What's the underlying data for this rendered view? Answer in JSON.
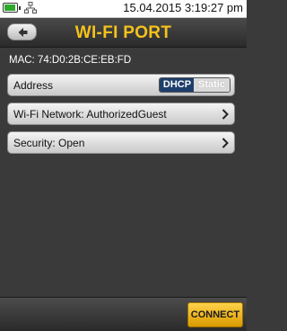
{
  "status_bar": {
    "datetime": "15.04.2015 3:19:27 pm",
    "icons": [
      "battery-icon",
      "network-icon"
    ],
    "battery_color": "#2ea82e"
  },
  "header": {
    "title": "WI-FI PORT",
    "back_icon": "back-arrow-icon",
    "title_color": "#f5c21b"
  },
  "mac": {
    "text": "MAC: 74:D0:2B:CE:EB:FD"
  },
  "rows": [
    {
      "label": "Address",
      "toggle": {
        "options": [
          "DHCP",
          "Static"
        ],
        "selected": "DHCP"
      }
    },
    {
      "label": "Wi-Fi Network: AuthorizedGuest",
      "icon": "chevron-right-icon"
    },
    {
      "label": "Security: Open",
      "icon": "chevron-right-icon"
    }
  ],
  "footer": {
    "connect_label": "CONNECT",
    "connect_color": "#f2b51d"
  }
}
